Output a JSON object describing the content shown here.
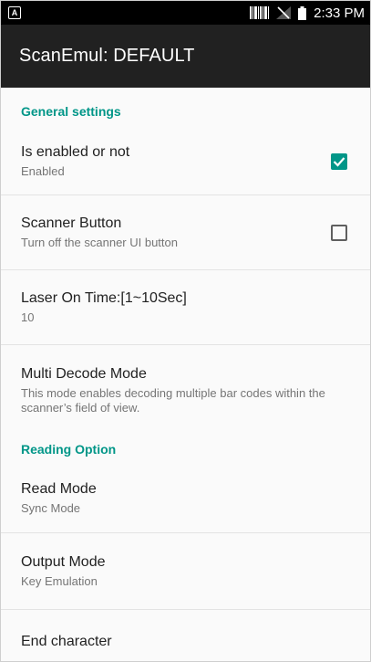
{
  "status_bar": {
    "time": "2:33 PM",
    "notification_letter": "A",
    "icons": [
      "barcode-icon",
      "no-signal-icon",
      "battery-icon"
    ]
  },
  "app_bar": {
    "title": "ScanEmul: DEFAULT"
  },
  "general_settings": {
    "header": "General settings",
    "items": [
      {
        "title": "Is enabled or not",
        "summary": "Enabled",
        "checked": true
      },
      {
        "title": "Scanner Button",
        "summary": "Turn off the scanner UI button",
        "checked": false
      },
      {
        "title": "Laser On Time:[1~10Sec]",
        "summary": "10"
      },
      {
        "title": "Multi Decode Mode",
        "summary": "This mode enables decoding multiple bar codes within the scanner’s field of view."
      }
    ]
  },
  "reading_option": {
    "header": "Reading Option",
    "items": [
      {
        "title": "Read Mode",
        "summary": "Sync Mode"
      },
      {
        "title": "Output Mode",
        "summary": "Key Emulation"
      },
      {
        "title": "End character"
      }
    ]
  },
  "colors": {
    "accent": "#009688",
    "app_bar": "#212121",
    "status_bar": "#000000",
    "background": "#fafafa"
  }
}
